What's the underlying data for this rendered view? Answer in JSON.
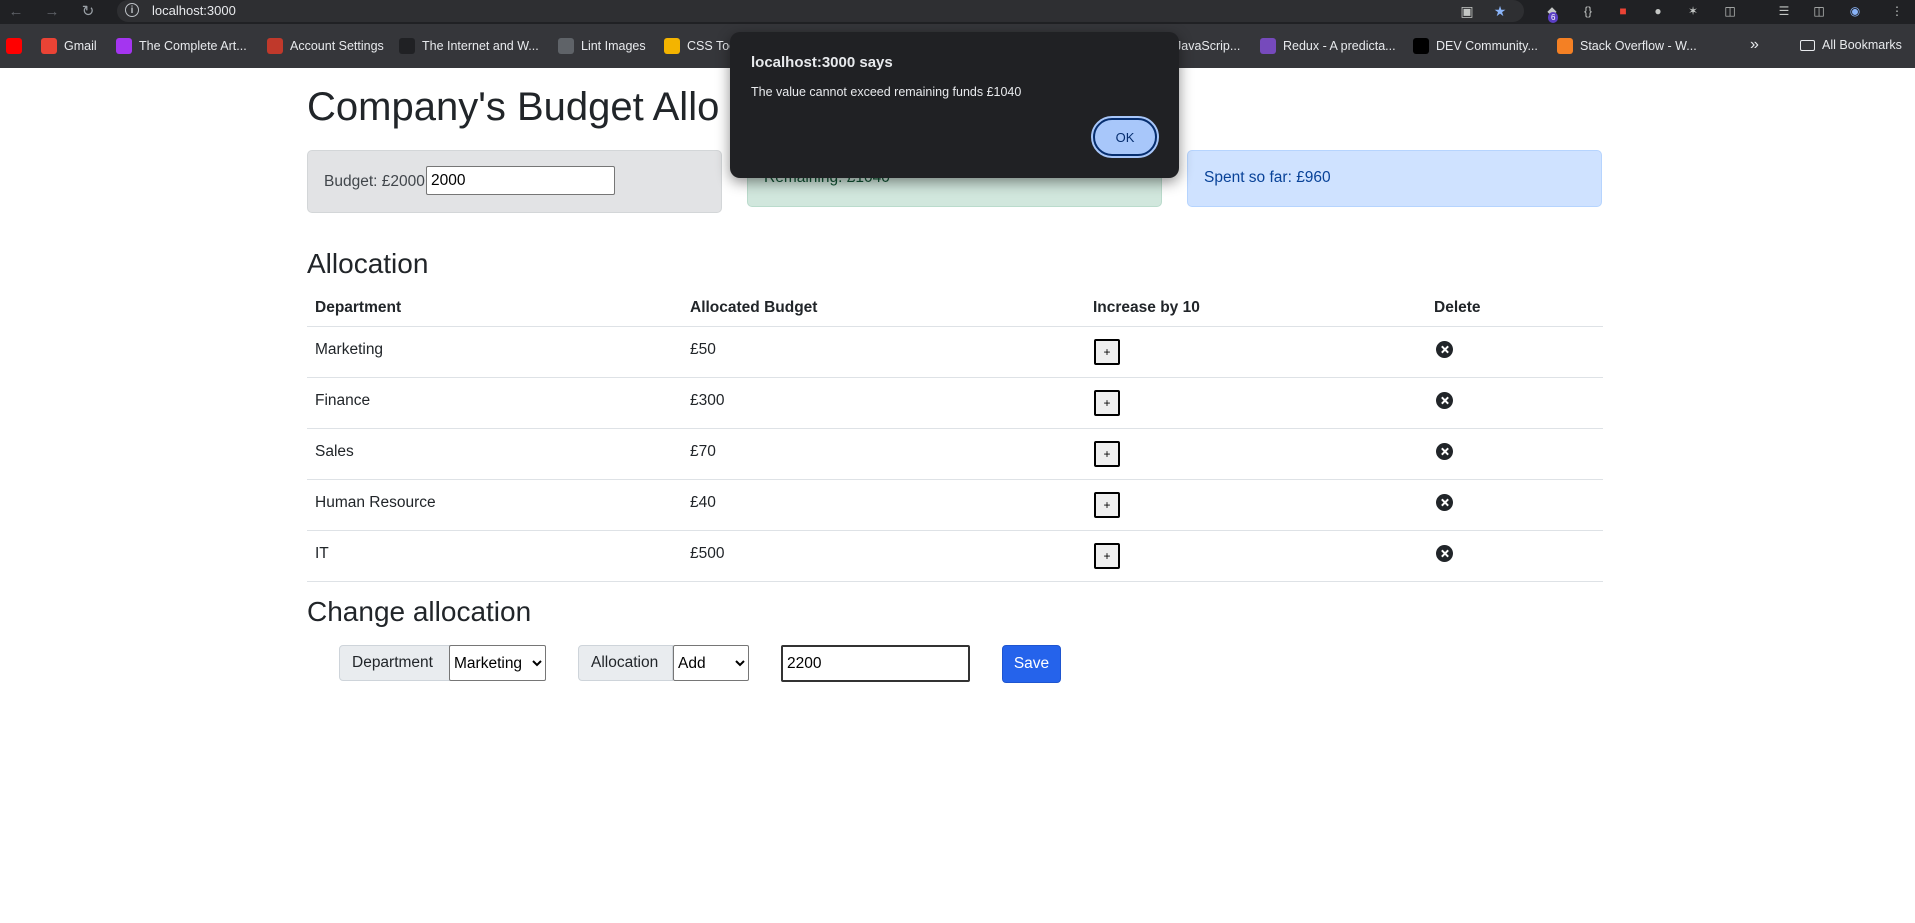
{
  "browser": {
    "url": "localhost:3000",
    "extension_badge": "6",
    "bookmarks": [
      {
        "label": "",
        "icon": "youtube-icon",
        "color": "#ff0000"
      },
      {
        "label": "Gmail",
        "icon": "gmail-icon",
        "color": "#ea4335"
      },
      {
        "label": "The Complete Art...",
        "icon": "udemy-icon",
        "color": "#a435f0"
      },
      {
        "label": "Account Settings",
        "icon": "account-settings-icon",
        "color": "#c0392b"
      },
      {
        "label": "The Internet and W...",
        "icon": "globe-dark-icon",
        "color": "#202124"
      },
      {
        "label": "Lint Images",
        "icon": "globe-icon",
        "color": "#5f6368"
      },
      {
        "label": "CSS Too",
        "icon": "css-icon",
        "color": "#f4b400"
      },
      {
        "label": "JavaScrip...",
        "icon": "bookmark-icon",
        "color": "#5f6368"
      },
      {
        "label": "Redux - A predicta...",
        "icon": "redux-icon",
        "color": "#764abc"
      },
      {
        "label": "DEV Community...",
        "icon": "dev-icon",
        "color": "#000000"
      },
      {
        "label": "Stack Overflow - W...",
        "icon": "stackoverflow-icon",
        "color": "#f48024"
      }
    ],
    "all_bookmarks": "All Bookmarks"
  },
  "page": {
    "title": "Company's Budget Allo",
    "budget_label": "Budget: £2000",
    "budget_value": "2000",
    "remaining_label": "Remaining: £1040",
    "spent_label": "Spent so far: £960"
  },
  "allocation": {
    "heading": "Allocation",
    "columns": [
      "Department",
      "Allocated Budget",
      "Increase by 10",
      "Delete"
    ],
    "increase_label": "+",
    "rows": [
      {
        "department": "Marketing",
        "budget": "£50"
      },
      {
        "department": "Finance",
        "budget": "£300"
      },
      {
        "department": "Sales",
        "budget": "£70"
      },
      {
        "department": "Human Resource",
        "budget": "£40"
      },
      {
        "department": "IT",
        "budget": "£500"
      }
    ]
  },
  "change": {
    "heading": "Change allocation",
    "department_label": "Department",
    "department_selected": "Marketing",
    "allocation_label": "Allocation",
    "allocation_selected": "Add",
    "cost_value": "2200",
    "save_label": "Save"
  },
  "alert": {
    "title": "localhost:3000 says",
    "message": "The value cannot exceed remaining funds  £1040",
    "ok_label": "OK"
  },
  "colors": {
    "accent": "#2563eb",
    "remaining_bg": "#d1e7dd",
    "spent_bg": "#cfe2ff",
    "budget_bg": "#e2e3e5"
  }
}
